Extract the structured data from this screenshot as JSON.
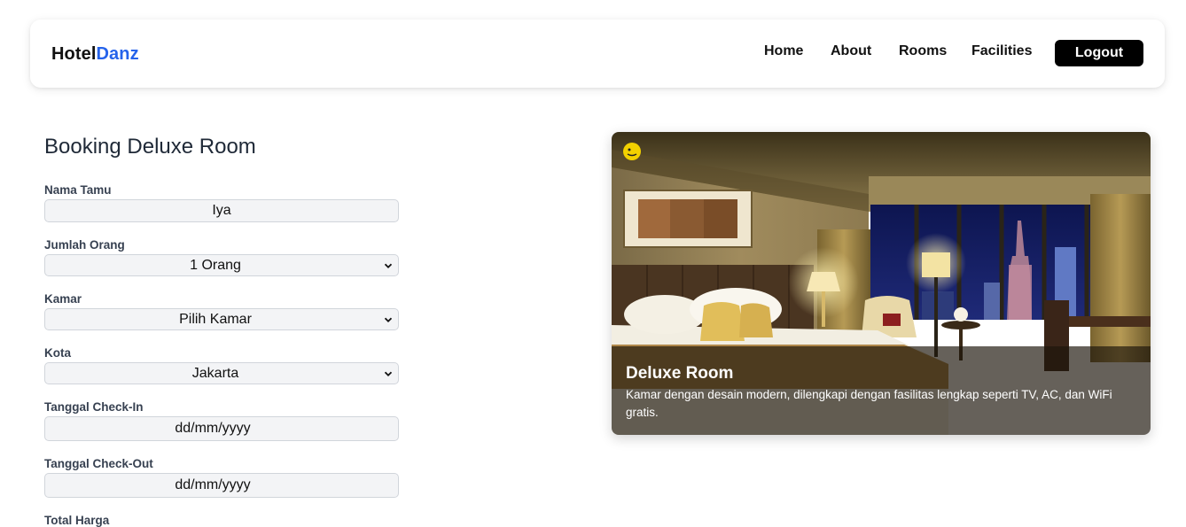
{
  "brand": {
    "part1": "Hotel",
    "part2": "Danz",
    "accent_color": "#2563eb"
  },
  "nav": {
    "links": [
      "Home",
      "About",
      "Rooms",
      "Facilities"
    ],
    "logout_label": "Logout"
  },
  "form": {
    "title": "Booking Deluxe Room",
    "fields": {
      "nama_tamu": {
        "label": "Nama Tamu",
        "value": "Iya"
      },
      "jumlah_orang": {
        "label": "Jumlah Orang",
        "value": "1 Orang"
      },
      "kamar": {
        "label": "Kamar",
        "value": "Pilih Kamar"
      },
      "kota": {
        "label": "Kota",
        "value": "Jakarta"
      },
      "check_in": {
        "label": "Tanggal Check-In",
        "value": "dd/mm/yyyy"
      },
      "check_out": {
        "label": "Tanggal Check-Out",
        "value": "dd/mm/yyyy"
      },
      "total_harga": {
        "label": "Total Harga"
      }
    }
  },
  "room_card": {
    "name": "Deluxe Room",
    "description": "Kamar dengan desain modern, dilengkapi dengan fasilitas lengkap seperti TV, AC, dan WiFi gratis.",
    "image_icon": "hotel-room-photo"
  }
}
